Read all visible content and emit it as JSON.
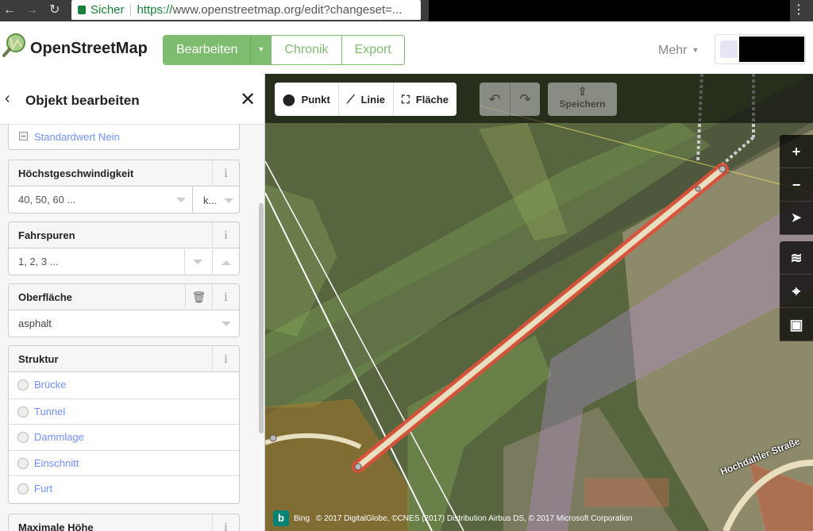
{
  "browser": {
    "back_icon": "←",
    "forward_icon": "→",
    "reload_icon": "↻",
    "secure_label": "Sicher",
    "url_https": "https://",
    "url_rest": "www.openstreetmap.org/edit?changeset=...",
    "menu_icon": "⋮"
  },
  "header": {
    "site_title": "OpenStreetMap",
    "edit_label": "Bearbeiten",
    "edit_caret": "▾",
    "history_label": "Chronik",
    "export_label": "Export",
    "more_label": "Mehr",
    "more_caret": "▼"
  },
  "sidebar": {
    "back_icon": "‹",
    "title": "Objekt bearbeiten",
    "close_icon": "✕",
    "default_checkbox": "Standardwert Nein",
    "fields": [
      {
        "label": "Höchstgeschwindigkeit",
        "placeholder": "40, 50, 60 ...",
        "unit": "k..."
      },
      {
        "label": "Fahrspuren",
        "placeholder": "1, 2, 3 ..."
      },
      {
        "label": "Oberfläche",
        "value": "asphalt"
      },
      {
        "label": "Struktur",
        "options": [
          "Brücke",
          "Tunnel",
          "Dammlage",
          "Einschnitt",
          "Furt"
        ]
      },
      {
        "label": "Maximale Höhe"
      }
    ],
    "info_icon": "i",
    "trash_icon": "🗑"
  },
  "map": {
    "modes": [
      {
        "icon": "⬤",
        "label": "Punkt"
      },
      {
        "icon": "⟋",
        "label": "Linie"
      },
      {
        "icon": "⛶",
        "label": "Fläche"
      }
    ],
    "undo_icon": "↶",
    "redo_icon": "↷",
    "save_icon": "⇪",
    "save_label": "Speichern",
    "controls": {
      "zoom_in": "+",
      "zoom_out": "−",
      "geolocate": "➤",
      "layers": "≋",
      "map_data": "⌖",
      "help": "▣"
    },
    "street_name": "Hochdahler Straße",
    "bing_logo": "b",
    "bing_label": "Bing",
    "attribution": "© 2017 DigitalGlobe, ©CNES (2017) Distribution Airbus DS, © 2017 Microsoft Corporation"
  },
  "colors": {
    "osm_green": "#7ebc6f",
    "selected_way": "#e0503a",
    "link_blue": "#7092ff"
  }
}
